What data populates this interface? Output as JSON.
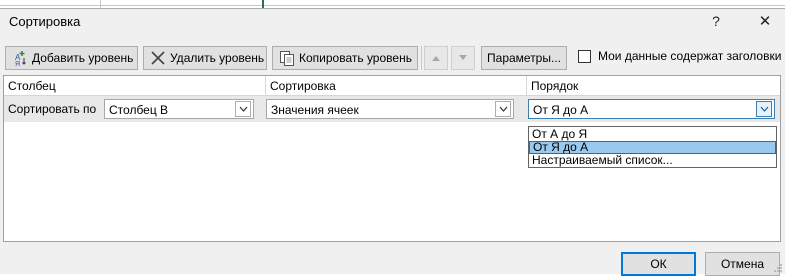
{
  "dialog": {
    "title": "Сортировка",
    "help_glyph": "?",
    "close_glyph": "✕"
  },
  "toolbar": {
    "add_level": "Добавить уровень",
    "delete_level": "Удалить уровень",
    "copy_level": "Копировать уровень",
    "options": "Параметры...",
    "has_headers_label": "Мои данные содержат заголовки",
    "has_headers_checked": false
  },
  "grid": {
    "headers": {
      "column": "Столбец",
      "sort_on": "Сортировка",
      "order": "Порядок"
    },
    "row": {
      "label": "Сортировать по",
      "column_value": "Столбец B",
      "sort_on_value": "Значения ячеек",
      "order_value": "От Я до А"
    }
  },
  "order_dropdown": {
    "options": [
      "От А до Я",
      "От Я до А",
      "Настраиваемый список..."
    ],
    "selected": "От Я до А"
  },
  "footer": {
    "ok": "ОК",
    "cancel": "Отмена"
  },
  "colors": {
    "accent": "#0078d7",
    "dialog_bg": "#f0f0f0",
    "highlight": "#99c9ef"
  }
}
